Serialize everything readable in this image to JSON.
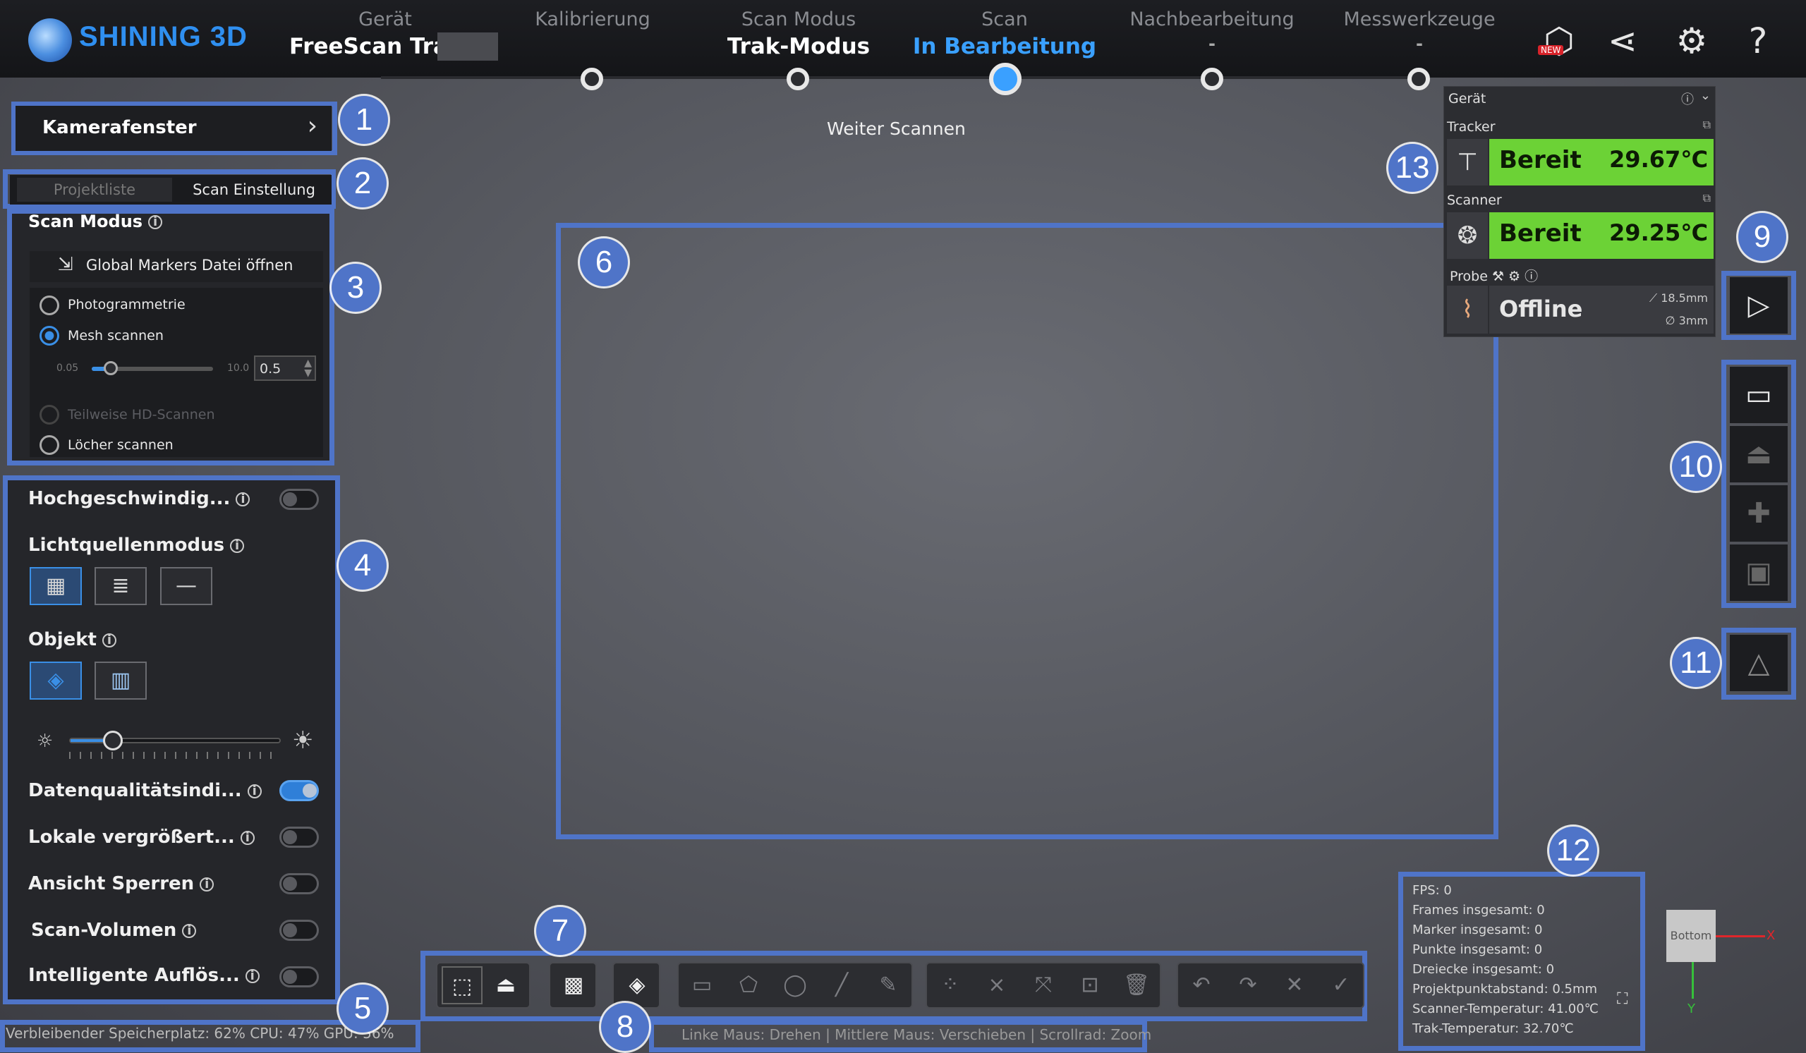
{
  "header": {
    "brand": "SHINING 3D",
    "steps": [
      {
        "label": "Gerät",
        "value": "FreeScan Trak"
      },
      {
        "label": "Kalibrierung",
        "value": ""
      },
      {
        "label": "Scan Modus",
        "value": "Trak-Modus"
      },
      {
        "label": "Scan",
        "value": "In Bearbeitung"
      },
      {
        "label": "Nachbearbeitung",
        "value": "-"
      },
      {
        "label": "Messwerkzeuge",
        "value": "-"
      }
    ],
    "new_badge": "NEW",
    "icons": [
      "new-3d-icon",
      "share-icon",
      "gear-icon",
      "help-icon"
    ]
  },
  "viewport": {
    "hint": "Weiter Scannen"
  },
  "left": {
    "camera_window": "Kamerafenster",
    "tabs": [
      "Projektliste",
      "Scan Einstellung"
    ],
    "scan_mode_title": "Scan Modus",
    "open_markers": "Global Markers Datei öffnen",
    "modes": [
      "Photogrammetrie",
      "Mesh scannen",
      "Teilweise HD-Scannen",
      "Löcher scannen"
    ],
    "resolution": {
      "min": "0.05",
      "max": "10.0",
      "value": "0.5",
      "fraction": 0.1
    },
    "settings": [
      {
        "label": "Hochgeschwindig...",
        "on": false
      },
      {
        "label": "Lichtquellenmodus"
      },
      {
        "label": "Objekt"
      },
      {
        "label": "Datenqualitätsindi...",
        "on": true
      },
      {
        "label": "Lokale vergrößert...",
        "on": false
      },
      {
        "label": "Ansicht Sperren",
        "on": false
      },
      {
        "label": "Scan-Volumen",
        "on": false
      },
      {
        "label": "Intelligente Auflös...",
        "on": false
      }
    ],
    "brightness_fraction": 0.2
  },
  "status_bar": {
    "resources": "Verbleibender Speicherplatz: 62%  CPU: 47%  GPU: 56%",
    "mouse_help": "Linke Maus: Drehen | Mittlere Maus: Verschieben | Scrollrad: Zoom"
  },
  "device": {
    "title": "Gerät",
    "tracker_label": "Tracker",
    "tracker_status": "Bereit",
    "tracker_temp": "29.67℃",
    "scanner_label": "Scanner",
    "scanner_status": "Bereit",
    "scanner_temp": "29.25℃",
    "probe_label": "Probe",
    "probe_status": "Offline",
    "probe_len": "18.5mm",
    "probe_dia": "3mm"
  },
  "stats": {
    "lines": [
      "FPS: 0",
      "Frames insgesamt: 0",
      "Marker insgesamt: 0",
      "Punkte insgesamt: 0",
      "Dreiecke insgesamt: 0",
      "Projektpunktabstand: 0.5mm",
      "Scanner-Temperatur: 41.00℃",
      "Trak-Temperatur: 32.70℃"
    ]
  },
  "axis": {
    "face": "Bottom",
    "x": "X",
    "y": "Y"
  },
  "callouts": [
    "1",
    "2",
    "3",
    "4",
    "5",
    "6",
    "7",
    "8",
    "9",
    "10",
    "11",
    "12",
    "13"
  ],
  "colors": {
    "accent": "#3a8fe6",
    "highlight": "#4f74c8",
    "ready": "#6cd236"
  }
}
